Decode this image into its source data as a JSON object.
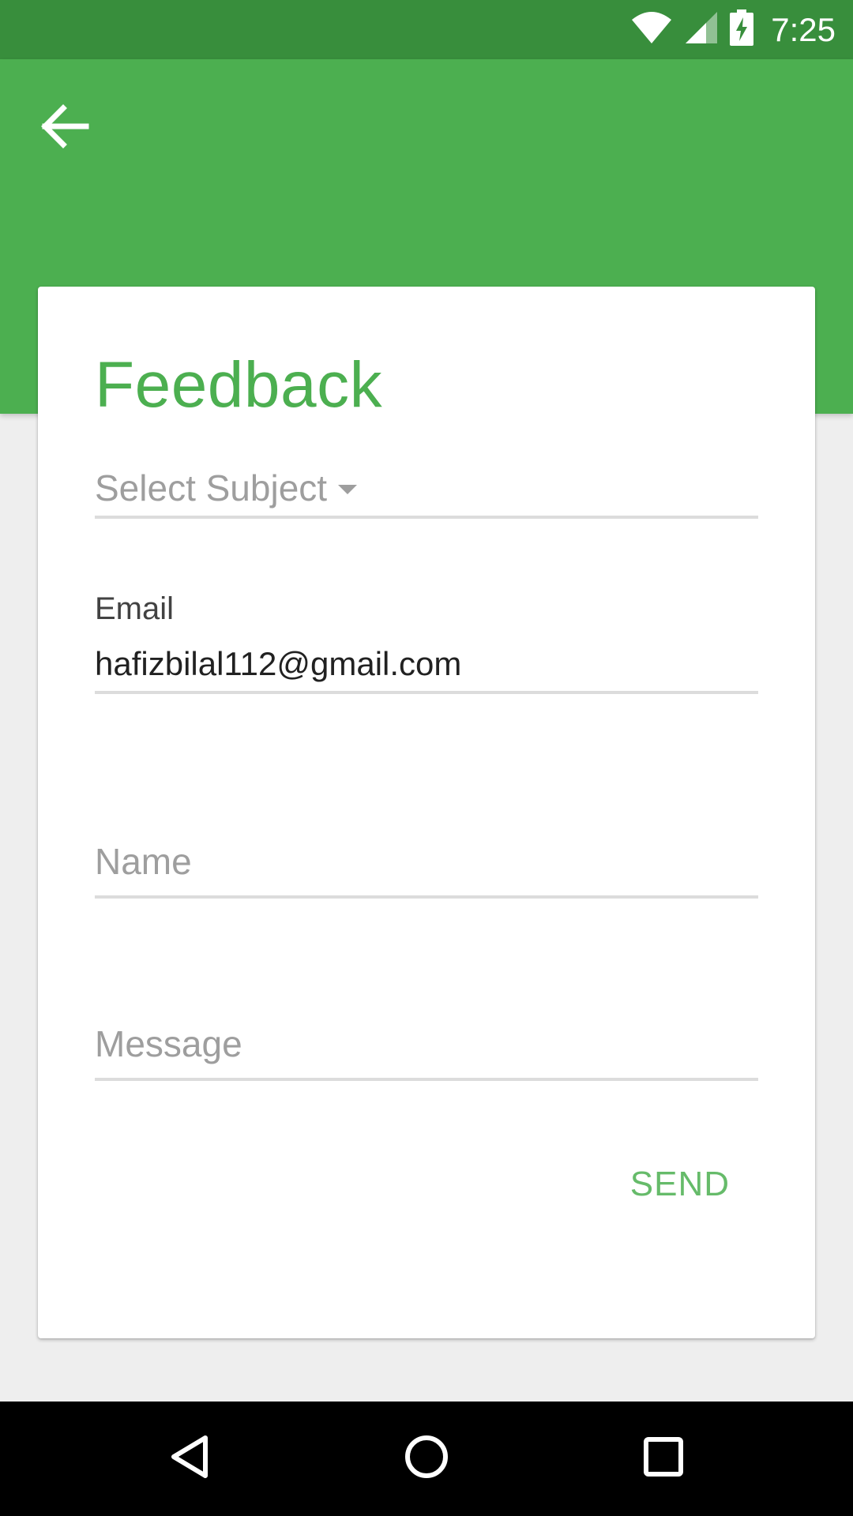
{
  "status_bar": {
    "time": "7:25",
    "icons": [
      "wifi-icon",
      "signal-icon",
      "battery-charging-icon"
    ]
  },
  "app_bar": {
    "back_icon": "arrow-back-icon"
  },
  "colors": {
    "status_bar": "#388e3c",
    "primary": "#4caf50",
    "accent_text": "#66bb6a",
    "background": "#eeeeee"
  },
  "form": {
    "title": "Feedback",
    "subject_placeholder": "Select Subject",
    "email_label": "Email",
    "email_value": "hafizbilal112@gmail.com",
    "name_placeholder": "Name",
    "message_placeholder": "Message",
    "send_label": "SEND"
  },
  "nav_bar": {
    "icons": [
      "back-triangle-icon",
      "home-circle-icon",
      "recents-square-icon"
    ]
  }
}
